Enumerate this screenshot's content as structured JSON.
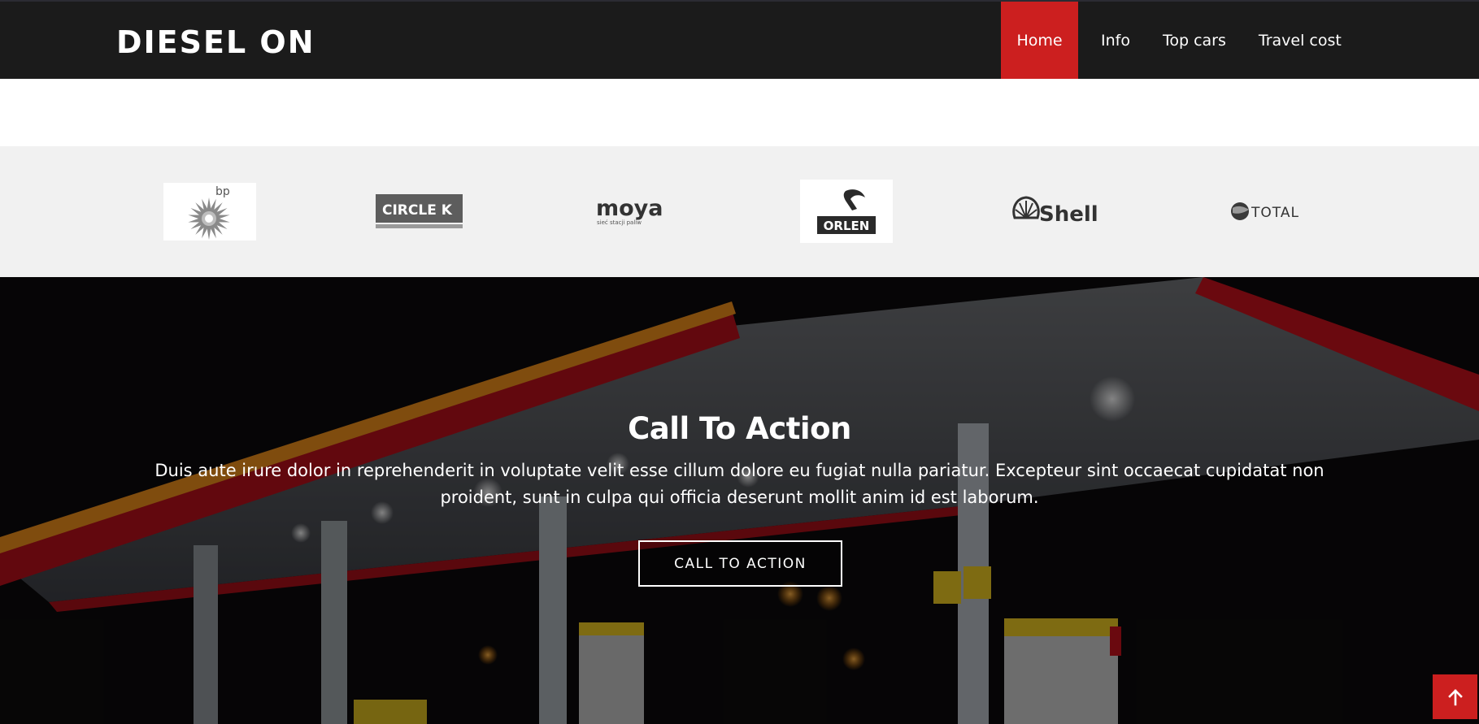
{
  "brand": {
    "name": "DIESEL ON"
  },
  "nav": {
    "items": [
      {
        "label": "Home",
        "active": true
      },
      {
        "label": "Info",
        "active": false
      },
      {
        "label": "Top cars",
        "active": false
      },
      {
        "label": "Travel cost",
        "active": false
      }
    ]
  },
  "clients": {
    "logos": [
      {
        "name": "bp",
        "icon": "bp-logo"
      },
      {
        "name": "CIRCLE K",
        "icon": "circle-k-logo"
      },
      {
        "name": "moya",
        "icon": "moya-logo",
        "tagline": "sieć stacji paliw"
      },
      {
        "name": "ORLEN",
        "icon": "orlen-logo"
      },
      {
        "name": "Shell",
        "icon": "shell-logo"
      },
      {
        "name": "TOTAL",
        "icon": "total-logo"
      }
    ]
  },
  "cta": {
    "title": "Call To Action",
    "text": "Duis aute irure dolor in reprehenderit in voluptate velit esse cillum dolore eu fugiat nulla pariatur. Excepteur sint occaecat cupidatat non proident, sunt in culpa qui officia deserunt mollit anim id est laborum.",
    "button_label": "CALL TO ACTION"
  },
  "back_to_top": {
    "icon": "arrow-up-icon"
  },
  "colors": {
    "accent": "#cc1f1f",
    "header_bg": "#1b1b1b",
    "clients_bg": "#f1f1f1"
  }
}
